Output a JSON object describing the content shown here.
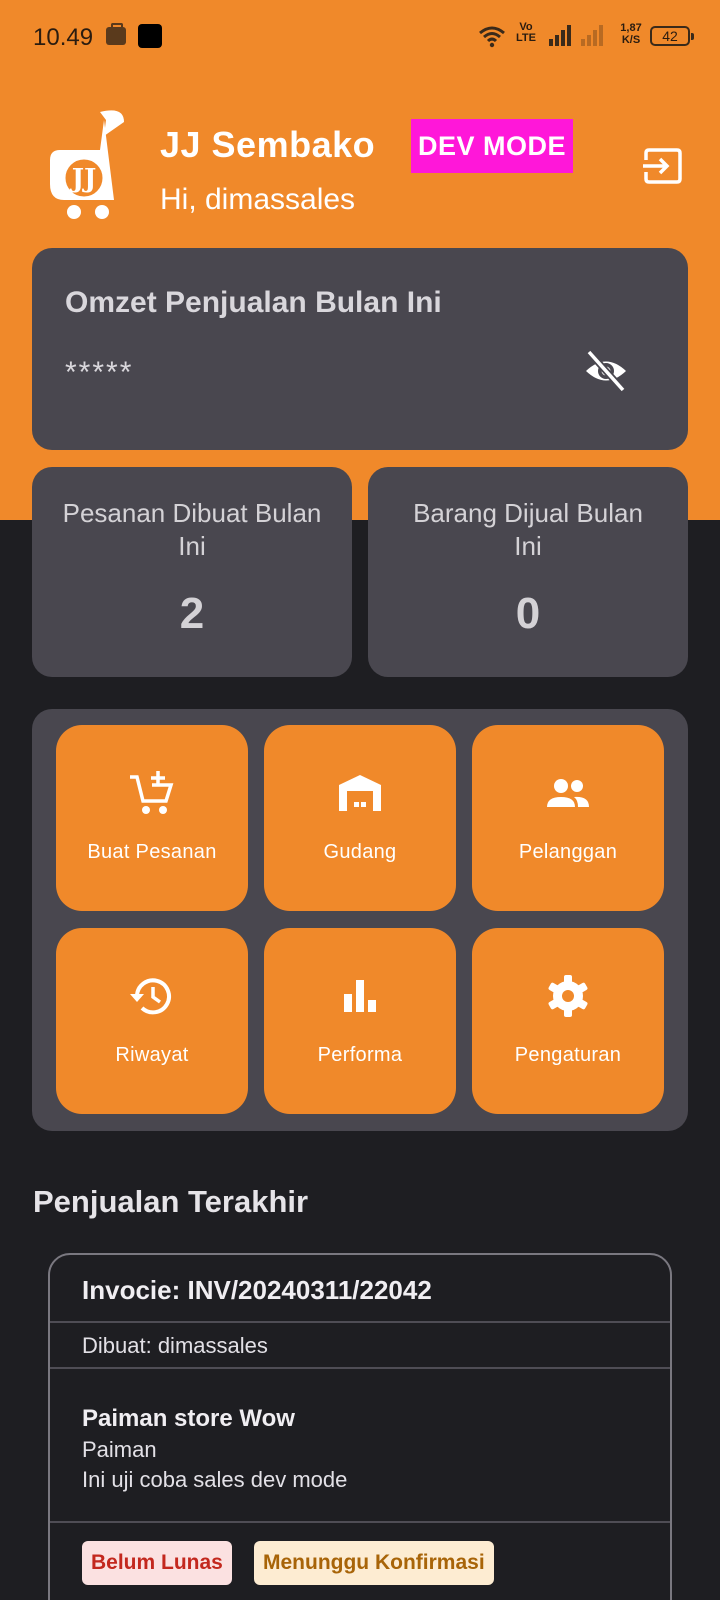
{
  "status_bar": {
    "time": "10.49",
    "network": "Vo\nLTE",
    "speed": "1,87\nK/S",
    "battery": "42"
  },
  "header": {
    "app_title": "JJ Sembako",
    "mode_badge": "DEV MODE",
    "greeting": "Hi, dimassales",
    "logo_letters": "JJ",
    "accent_color": "#f0892a",
    "badge_color": "#ff17d9"
  },
  "omzet": {
    "title": "Omzet Penjualan Bulan Ini",
    "value": "*****",
    "toggle_icon": "eye-off-icon"
  },
  "stats": [
    {
      "label": "Pesanan Dibuat Bulan Ini",
      "value": "2"
    },
    {
      "label": "Barang Dijual Bulan Ini",
      "value": "0"
    }
  ],
  "menu": [
    {
      "label": "Buat Pesanan",
      "icon": "add-cart-icon"
    },
    {
      "label": "Gudang",
      "icon": "warehouse-icon"
    },
    {
      "label": "Pelanggan",
      "icon": "people-icon"
    },
    {
      "label": "Riwayat",
      "icon": "history-icon"
    },
    {
      "label": "Performa",
      "icon": "bar-chart-icon"
    },
    {
      "label": "Pengaturan",
      "icon": "gear-icon"
    }
  ],
  "recent_sales": {
    "title": "Penjualan Terakhir",
    "invoices": [
      {
        "invoice": "Invocie: INV/20240311/22042",
        "created_by": "Dibuat: dimassales",
        "store": "Paiman store Wow",
        "owner": "Paiman",
        "note": "Ini uji coba sales dev mode",
        "payment_status": "Belum Lunas",
        "order_status": "Menunggu Konfirmasi"
      }
    ]
  }
}
